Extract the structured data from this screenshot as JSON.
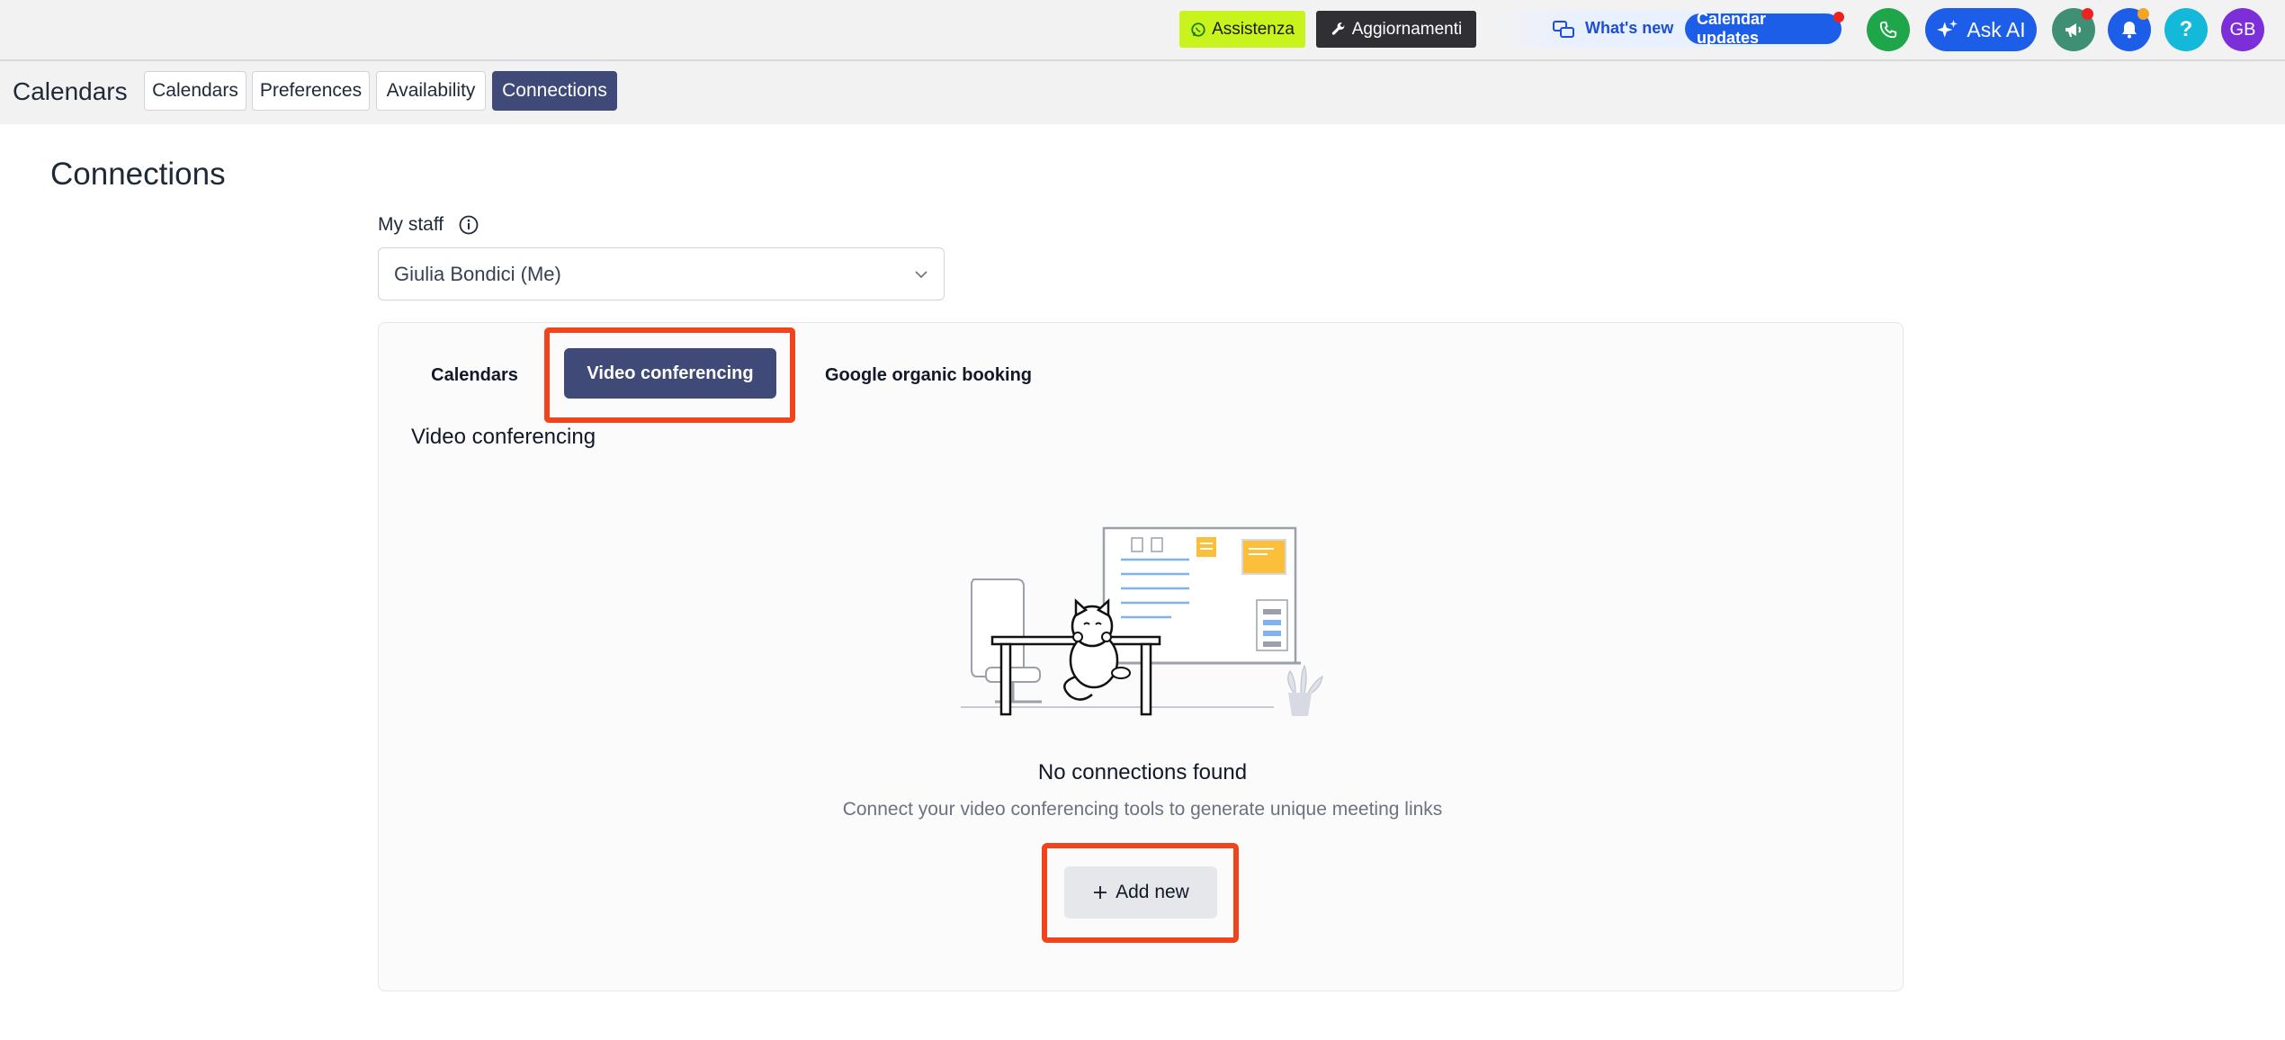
{
  "topbar": {
    "assistenza_label": "Assistenza",
    "aggiornamenti_label": "Aggiornamenti",
    "whats_new_label": "What's new",
    "calendar_updates_label": "Calendar updates",
    "ask_ai_label": "Ask AI",
    "help_label": "?",
    "avatar_initials": "GB"
  },
  "subbar": {
    "title": "Calendars",
    "tabs": [
      {
        "label": "Calendars"
      },
      {
        "label": "Preferences"
      },
      {
        "label": "Availability"
      },
      {
        "label": "Connections"
      }
    ]
  },
  "page": {
    "title": "Connections",
    "staff_label": "My staff",
    "staff_value": "Giulia Bondici (Me)"
  },
  "card": {
    "tabs": [
      {
        "label": "Calendars"
      },
      {
        "label": "Video conferencing"
      },
      {
        "label": "Google organic booking"
      }
    ],
    "section_title": "Video conferencing",
    "empty_title": "No connections found",
    "empty_subtitle": "Connect your video conferencing tools to generate unique meeting links",
    "add_button_label": "Add new"
  },
  "colors": {
    "primary": "#3f4a78",
    "highlight": "#f0441d",
    "brand_blue": "#1d5ee8",
    "assist_green": "#c9f31d"
  }
}
